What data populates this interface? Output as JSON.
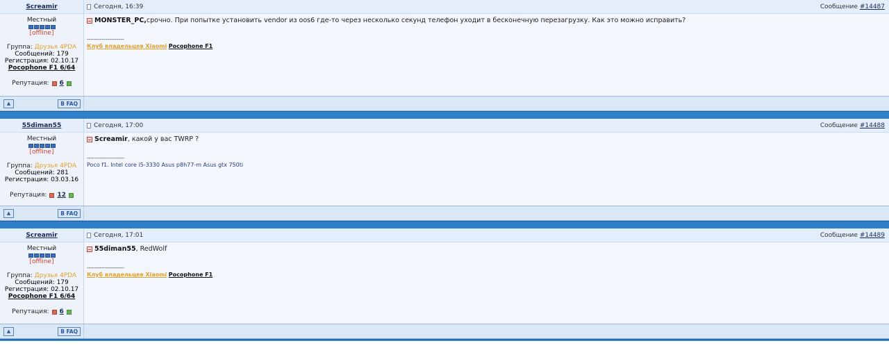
{
  "posts": [
    {
      "author": "Screamir",
      "date": "Сегодня, 16:39",
      "msg_label": "Сообщение",
      "msg_no": "#14487",
      "rank": "Местный",
      "status": "[offline]",
      "group_label": "Группа:",
      "group": "Друзья 4PDA",
      "messages": "Сообщений: 179",
      "reg": "Регистрация: 02.10.17",
      "device": "Pocophone F1 6/64",
      "rep_label": "Репутация:",
      "rep": "6",
      "reply_to": "MONSTER_PC,",
      "text": " срочно. При попытке установить vendor из oos6 где-то через несколько секунд телефон уходит в бесконечную перезагрузку. Как это можно исправить?",
      "sep": "--------------------",
      "sig_club": "Клуб владельцев Xiaomi",
      "sig_poco": "Pocophone F1"
    },
    {
      "author": "55diman55",
      "date": "Сегодня, 17:00",
      "msg_label": "Сообщение",
      "msg_no": "#14488",
      "rank": "Местный",
      "status": "[offline]",
      "group_label": "Группа:",
      "group": "Друзья 4PDA",
      "messages": "Сообщений: 281",
      "reg": "Регистрация: 03.03.16",
      "rep_label": "Репутация:",
      "rep": "12",
      "reply_to": "Screamir",
      "text": ", какой у вас TWRP ?",
      "sep": "--------------------",
      "sig_plain": "Poco f1. Intel core i5-3330 Asus p8h77-m Asus gtx 750ti"
    },
    {
      "author": "Screamir",
      "date": "Сегодня, 17:01",
      "msg_label": "Сообщение",
      "msg_no": "#14489",
      "rank": "Местный",
      "status": "[offline]",
      "group_label": "Группа:",
      "group": "Друзья 4PDA",
      "messages": "Сообщений: 179",
      "reg": "Регистрация: 02.10.17",
      "device": "Pocophone F1 6/64",
      "rep_label": "Репутация:",
      "rep": "6",
      "reply_to": "55diman55",
      "text": ", RedWolf",
      "sep": "--------------------",
      "sig_club": "Клуб владельцев Xiaomi",
      "sig_poco": "Pocophone F1"
    }
  ],
  "footer": {
    "faq": "В FAQ",
    "up_icon": "up-arrow-icon"
  }
}
